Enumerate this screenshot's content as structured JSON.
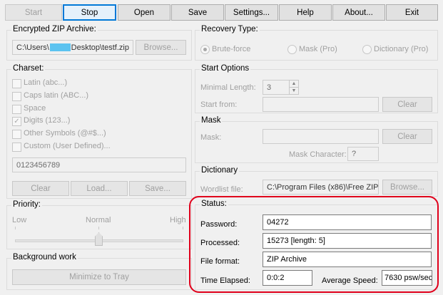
{
  "toolbar": {
    "start": "Start",
    "stop": "Stop",
    "open": "Open",
    "save": "Save",
    "settings": "Settings...",
    "help": "Help",
    "about": "About...",
    "exit": "Exit"
  },
  "archive": {
    "title": "Encrypted ZIP Archive:",
    "path_prefix": "C:\\Users\\",
    "path_suffix": "Desktop\\testf.zip",
    "browse": "Browse..."
  },
  "charset": {
    "title": "Charset:",
    "options": [
      {
        "label": "Latin (abc...)",
        "checked": false
      },
      {
        "label": "Caps latin (ABC...)",
        "checked": false
      },
      {
        "label": "Space",
        "checked": false
      },
      {
        "label": "Digits (123...)",
        "checked": true
      },
      {
        "label": "Other Symbols (@#$...)",
        "checked": false
      },
      {
        "label": "Custom (User Defined)...",
        "checked": false
      }
    ],
    "custom_value": "0123456789",
    "clear": "Clear",
    "load": "Load...",
    "save": "Save..."
  },
  "priority": {
    "title": "Priority:",
    "low": "Low",
    "normal": "Normal",
    "high": "High"
  },
  "background": {
    "title": "Background work",
    "minimize": "Minimize to Tray"
  },
  "recovery": {
    "title": "Recovery Type:",
    "options": [
      "Brute-force",
      "Mask (Pro)",
      "Dictionary (Pro)"
    ],
    "selected": "Brute-force"
  },
  "start_options": {
    "title": "Start Options",
    "min_length_label": "Minimal Length:",
    "min_length_value": "3",
    "start_from_label": "Start from:",
    "start_from_value": "",
    "clear": "Clear"
  },
  "mask": {
    "title": "Mask",
    "mask_label": "Mask:",
    "mask_value": "",
    "clear": "Clear",
    "mask_char_label": "Mask Character:",
    "mask_char_value": "?"
  },
  "dictionary": {
    "title": "Dictionary",
    "wordlist_label": "Wordlist file:",
    "wordlist_value": "C:\\Program Files (x86)\\Free ZIP",
    "browse": "Browse..."
  },
  "status": {
    "title": "Status:",
    "password_label": "Password:",
    "password_value": "04272",
    "processed_label": "Processed:",
    "processed_value": "15273 [length: 5]",
    "format_label": "File format:",
    "format_value": "ZIP Archive",
    "elapsed_label": "Time Elapsed:",
    "elapsed_value": "0:0:2",
    "speed_label": "Average Speed:",
    "speed_value": "7630 psw/sec"
  },
  "colors": {
    "highlight": "#e0001b",
    "redaction": "#5cc3f0",
    "focus": "#0078d7"
  }
}
